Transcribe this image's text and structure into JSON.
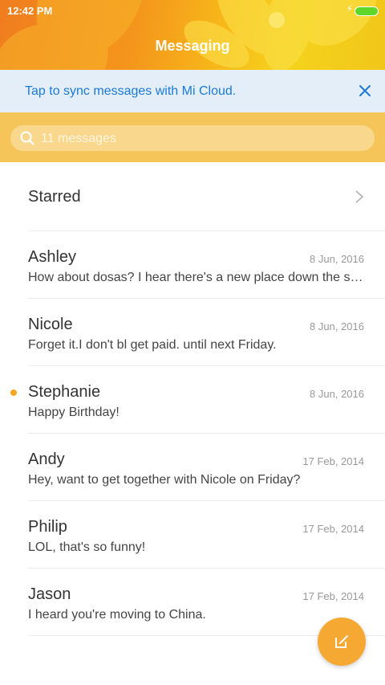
{
  "status_bar": {
    "time": "12:42 PM",
    "charging_icon": "bolt-icon",
    "battery_icon": "battery-icon"
  },
  "header": {
    "title": "Messaging"
  },
  "sync_banner": {
    "text": "Tap to sync messages with Mi Cloud.",
    "close_icon": "close-icon"
  },
  "search": {
    "placeholder": "11 messages",
    "value": "",
    "icon": "search-icon"
  },
  "starred": {
    "label": "Starred",
    "icon": "chevron-right-icon"
  },
  "conversations": [
    {
      "name": "Ashley",
      "date": "8 Jun, 2016",
      "preview": "How about dosas? I hear there's a new place down the st…",
      "unread": false
    },
    {
      "name": "Nicole",
      "date": "8 Jun, 2016",
      "preview": "Forget it.I don't bl get paid. until next Friday.",
      "unread": false
    },
    {
      "name": "Stephanie",
      "date": "8 Jun, 2016",
      "preview": "Happy Birthday!",
      "unread": true
    },
    {
      "name": "Andy",
      "date": "17 Feb, 2014",
      "preview": "Hey, want to get together with Nicole on Friday?",
      "unread": false
    },
    {
      "name": "Philip",
      "date": "17 Feb, 2014",
      "preview": "LOL, that's so funny!",
      "unread": false
    },
    {
      "name": "Jason",
      "date": "17 Feb, 2014",
      "preview": "I heard you're moving to China.",
      "unread": false
    }
  ],
  "compose": {
    "icon": "compose-icon"
  },
  "colors": {
    "header_start": "#f07d1e",
    "header_end": "#f5d31c",
    "sync_bg": "#e4eef8",
    "sync_text": "#1a7ad6",
    "search_bg": "#f6c55a",
    "unread_dot": "#f5a623",
    "fab": "#f5a832"
  }
}
